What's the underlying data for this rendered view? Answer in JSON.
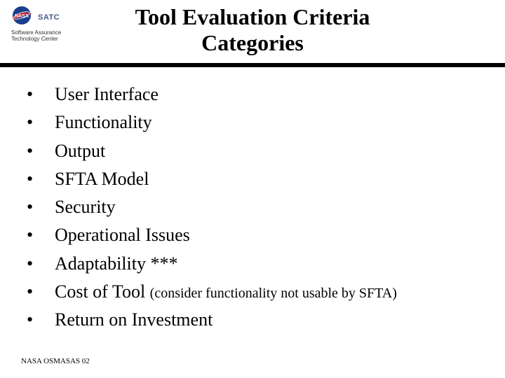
{
  "header": {
    "logo_satc": "SATC",
    "logo_sub_line1": "Software Assurance",
    "logo_sub_line2": "Technology Center",
    "title_line1": "Tool Evaluation Criteria",
    "title_line2": "Categories"
  },
  "bullets": [
    {
      "text": "User Interface",
      "paren": ""
    },
    {
      "text": "Functionality",
      "paren": ""
    },
    {
      "text": "Output",
      "paren": ""
    },
    {
      "text": "SFTA Model",
      "paren": ""
    },
    {
      "text": "Security",
      "paren": ""
    },
    {
      "text": "Operational Issues",
      "paren": ""
    },
    {
      "text": "Adaptability ***",
      "paren": ""
    },
    {
      "text": "Cost of Tool ",
      "paren": "(consider functionality not usable by SFTA)"
    },
    {
      "text": "Return on Investment",
      "paren": ""
    }
  ],
  "footer": "NASA OSMASAS 02"
}
